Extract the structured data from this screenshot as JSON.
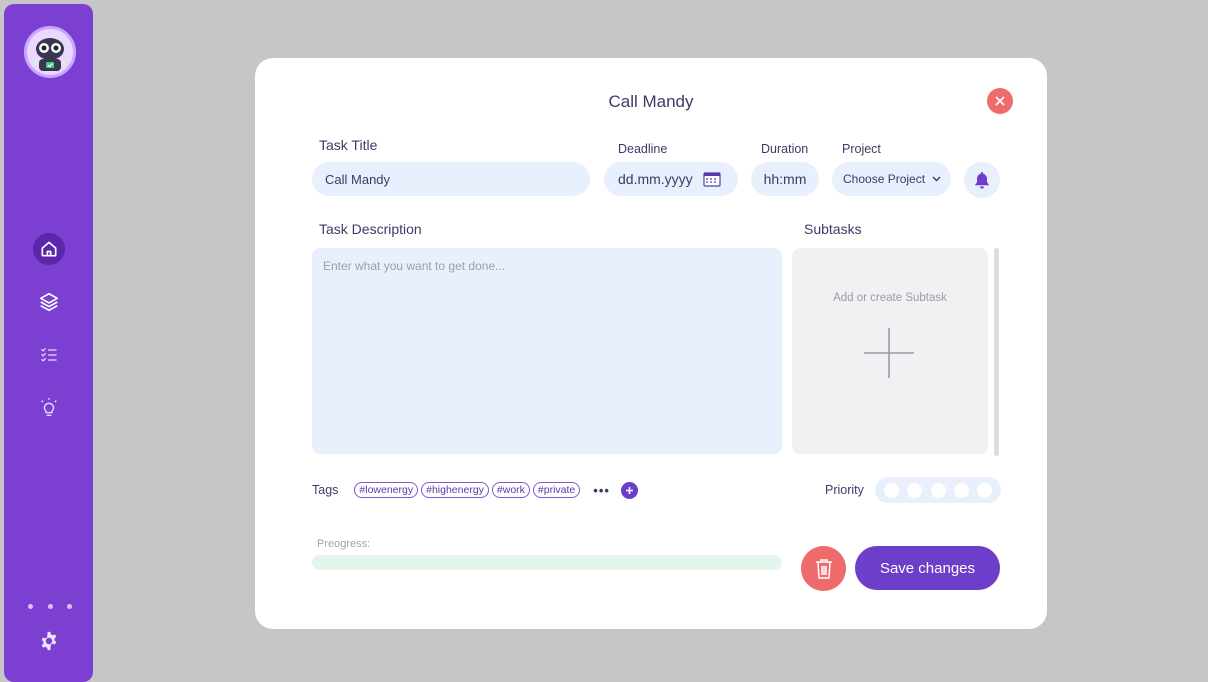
{
  "sidebar": {
    "icons": [
      "home-icon",
      "layers-icon",
      "checklist-icon",
      "lightbulb-icon",
      "more-icon",
      "gear-icon"
    ],
    "active_item": "home"
  },
  "modal": {
    "title": "Call Mandy",
    "task_title": {
      "label": "Task Title",
      "value": "Call Mandy"
    },
    "deadline": {
      "label": "Deadline",
      "placeholder": "dd.mm.yyyy"
    },
    "duration": {
      "label": "Duration",
      "placeholder": "hh:mm"
    },
    "project": {
      "label": "Project",
      "value": "Choose Project"
    },
    "description": {
      "label": "Task Description",
      "placeholder": "Enter what you want to get done..."
    },
    "subtasks": {
      "label": "Subtasks",
      "empty_text": "Add or create Subtask"
    },
    "tags": {
      "label": "Tags",
      "items": [
        "#lowenergy",
        "#highenergy",
        "#work",
        "#private"
      ],
      "more": "•••"
    },
    "priority": {
      "label": "Priority",
      "level": 0,
      "max": 5
    },
    "progress": {
      "label": "Preogress:",
      "value": 0
    },
    "save_label": "Save changes"
  },
  "colors": {
    "accent": "#6b3fc9",
    "sidebar": "#7b3fd2",
    "danger": "#ef6b6b",
    "input_bg": "#e8effd",
    "progress_bg": "#e2f6ec",
    "backdrop": "#c6c6c6"
  }
}
